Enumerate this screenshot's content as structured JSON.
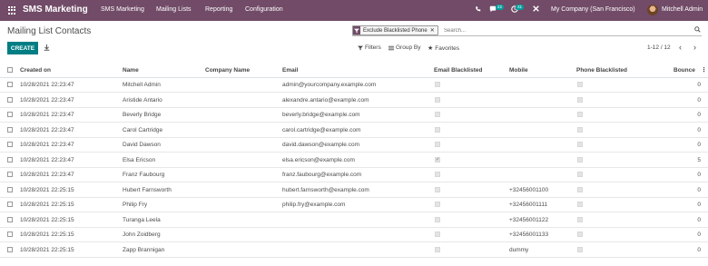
{
  "navbar": {
    "brand": "SMS Marketing",
    "menu": [
      "SMS Marketing",
      "Mailing Lists",
      "Reporting",
      "Configuration"
    ],
    "messages_count": "22",
    "activities_count": "31",
    "company": "My Company (San Francisco)",
    "user": "Mitchell Admin"
  },
  "page": {
    "breadcrumb": "Mailing List Contacts"
  },
  "search": {
    "facet_label": "Exclude Blacklisted Phone",
    "placeholder": "Search..."
  },
  "toolbar": {
    "create_label": "CREATE",
    "filters_label": "Filters",
    "group_by_label": "Group By",
    "favorites_label": "Favorites",
    "pager": "1-12 / 12"
  },
  "table": {
    "columns": [
      "Created on",
      "Name",
      "Company Name",
      "Email",
      "Email Blacklisted",
      "Mobile",
      "Phone Blacklisted",
      "Bounce"
    ],
    "rows": [
      {
        "created": "10/28/2021 22:23:47",
        "name": "Mitchell Admin",
        "company": "",
        "email": "admin@yourcompany.example.com",
        "email_bl": false,
        "mobile": "",
        "phone_bl": false,
        "bounce": "0"
      },
      {
        "created": "10/28/2021 22:23:47",
        "name": "Aristide Antario",
        "company": "",
        "email": "alexandre.antario@example.com",
        "email_bl": false,
        "mobile": "",
        "phone_bl": false,
        "bounce": "0"
      },
      {
        "created": "10/28/2021 22:23:47",
        "name": "Beverly Bridge",
        "company": "",
        "email": "beverly.bridge@example.com",
        "email_bl": false,
        "mobile": "",
        "phone_bl": false,
        "bounce": "0"
      },
      {
        "created": "10/28/2021 22:23:47",
        "name": "Carol Cartridge",
        "company": "",
        "email": "carol.cartridge@example.com",
        "email_bl": false,
        "mobile": "",
        "phone_bl": false,
        "bounce": "0"
      },
      {
        "created": "10/28/2021 22:23:47",
        "name": "David Dawson",
        "company": "",
        "email": "david.dawson@example.com",
        "email_bl": false,
        "mobile": "",
        "phone_bl": false,
        "bounce": "0"
      },
      {
        "created": "10/28/2021 22:23:47",
        "name": "Elsa Ericson",
        "company": "",
        "email": "elsa.ericson@example.com",
        "email_bl": true,
        "mobile": "",
        "phone_bl": false,
        "bounce": "5"
      },
      {
        "created": "10/28/2021 22:23:47",
        "name": "Franz Faubourg",
        "company": "",
        "email": "franz.faubourg@example.com",
        "email_bl": false,
        "mobile": "",
        "phone_bl": false,
        "bounce": "0"
      },
      {
        "created": "10/28/2021 22:25:15",
        "name": "Hubert Farnsworth",
        "company": "",
        "email": "hubert.farnsworth@example.com",
        "email_bl": false,
        "mobile": "+32456001100",
        "phone_bl": false,
        "bounce": "0"
      },
      {
        "created": "10/28/2021 22:25:15",
        "name": "Philip Fry",
        "company": "",
        "email": "philip.fry@example.com",
        "email_bl": false,
        "mobile": "+32456001111",
        "phone_bl": false,
        "bounce": "0"
      },
      {
        "created": "10/28/2021 22:25:15",
        "name": "Turanga Leela",
        "company": "",
        "email": "",
        "email_bl": false,
        "mobile": "+32456001122",
        "phone_bl": false,
        "bounce": "0"
      },
      {
        "created": "10/28/2021 22:25:15",
        "name": "John Zoidberg",
        "company": "",
        "email": "",
        "email_bl": false,
        "mobile": "+32456001133",
        "phone_bl": false,
        "bounce": "0"
      },
      {
        "created": "10/28/2021 22:25:15",
        "name": "Zapp Brannigan",
        "company": "",
        "email": "",
        "email_bl": false,
        "mobile": "dummy",
        "phone_bl": false,
        "bounce": "0"
      }
    ]
  },
  "colors": {
    "navbar": "#714b67",
    "primary_button": "#017e84",
    "badge": "#00a09d"
  }
}
